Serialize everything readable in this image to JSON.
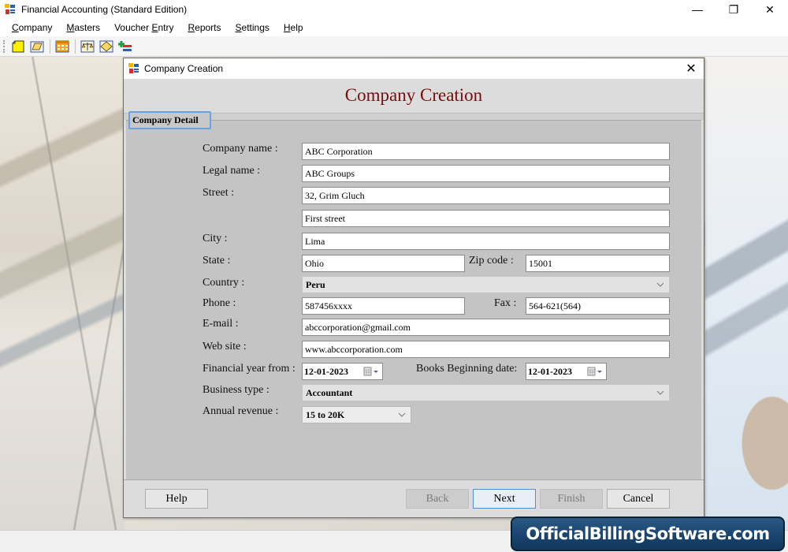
{
  "window": {
    "title": "Financial Accounting (Standard Edition)",
    "controls": {
      "minimize": "—",
      "restore": "❐",
      "close": "✕"
    }
  },
  "menu": {
    "items": [
      {
        "label": "Company",
        "mnemonic": "C",
        "rest": "ompany"
      },
      {
        "label": "Masters",
        "mnemonic": "M",
        "rest": "asters"
      },
      {
        "label": "Voucher Entry",
        "pre": "Voucher ",
        "mnemonic": "E",
        "rest": "ntry"
      },
      {
        "label": "Reports",
        "mnemonic": "R",
        "rest": "eports"
      },
      {
        "label": "Settings",
        "mnemonic": "S",
        "rest": "ettings"
      },
      {
        "label": "Help",
        "mnemonic": "H",
        "rest": "elp"
      }
    ]
  },
  "toolbar": {
    "buttons": [
      "new-company-icon",
      "open-company-icon",
      "ledger-grid-icon",
      "balance-scale-icon",
      "voucher-icon",
      "add-entry-icon"
    ]
  },
  "dialog": {
    "title": "Company Creation",
    "heading": "Company Creation",
    "close": "✕",
    "tab": "Company Detail",
    "accent_color": "#7b0c0c",
    "form": {
      "company_name": {
        "label": "Company name :",
        "value": "ABC Corporation"
      },
      "legal_name": {
        "label": "Legal name :",
        "value": "ABC Groups"
      },
      "street": {
        "label": "Street :",
        "value1": "32, Grim Gluch",
        "value2": "First street"
      },
      "city": {
        "label": "City :",
        "value": "Lima"
      },
      "state": {
        "label": "State :",
        "value": "Ohio"
      },
      "zip": {
        "label": "Zip code :",
        "value": "15001"
      },
      "country": {
        "label": "Country :",
        "value": "Peru"
      },
      "phone": {
        "label": "Phone :",
        "value": "587456xxxx"
      },
      "fax": {
        "label": "Fax :",
        "value": "564-621(564)"
      },
      "email": {
        "label": "E-mail :",
        "value": "abccorporation@gmail.com"
      },
      "website": {
        "label": "Web site :",
        "value": "www.abccorporation.com"
      },
      "fy_from": {
        "label": "Financial year from :",
        "value": "12-01-2023"
      },
      "books_begin": {
        "label": "Books Beginning date:",
        "value": "12-01-2023"
      },
      "business_type": {
        "label": "Business type :",
        "value": "Accountant"
      },
      "annual_revenue": {
        "label": "Annual revenue :",
        "value": "15 to 20K"
      }
    },
    "buttons": {
      "help": "Help",
      "back": "Back",
      "next": "Next",
      "finish": "Finish",
      "cancel": "Cancel"
    }
  },
  "watermark": "OfficialBillingSoftware.com"
}
